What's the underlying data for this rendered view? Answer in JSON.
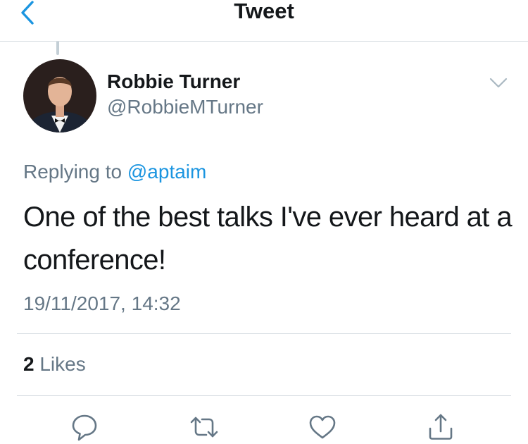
{
  "header": {
    "title": "Tweet",
    "back_icon": "chevron-left-icon"
  },
  "tweet": {
    "author_name": "Robbie Turner",
    "author_handle": "@RobbieMTurner",
    "replying_prefix": "Replying to",
    "replying_mention": "@aptaim",
    "text": "One of the best talks I've ever heard at a conference!",
    "timestamp": "19/11/2017, 14:32",
    "likes_count": "2",
    "likes_label": "Likes"
  },
  "actions": [
    {
      "name": "reply",
      "icon": "speech-bubble-icon"
    },
    {
      "name": "retweet",
      "icon": "retweet-icon"
    },
    {
      "name": "like",
      "icon": "heart-icon"
    },
    {
      "name": "share",
      "icon": "share-icon"
    }
  ],
  "colors": {
    "accent": "#1b95e0",
    "secondary_text": "#657786",
    "primary_text": "#14171a",
    "divider": "#d4dbe0"
  }
}
